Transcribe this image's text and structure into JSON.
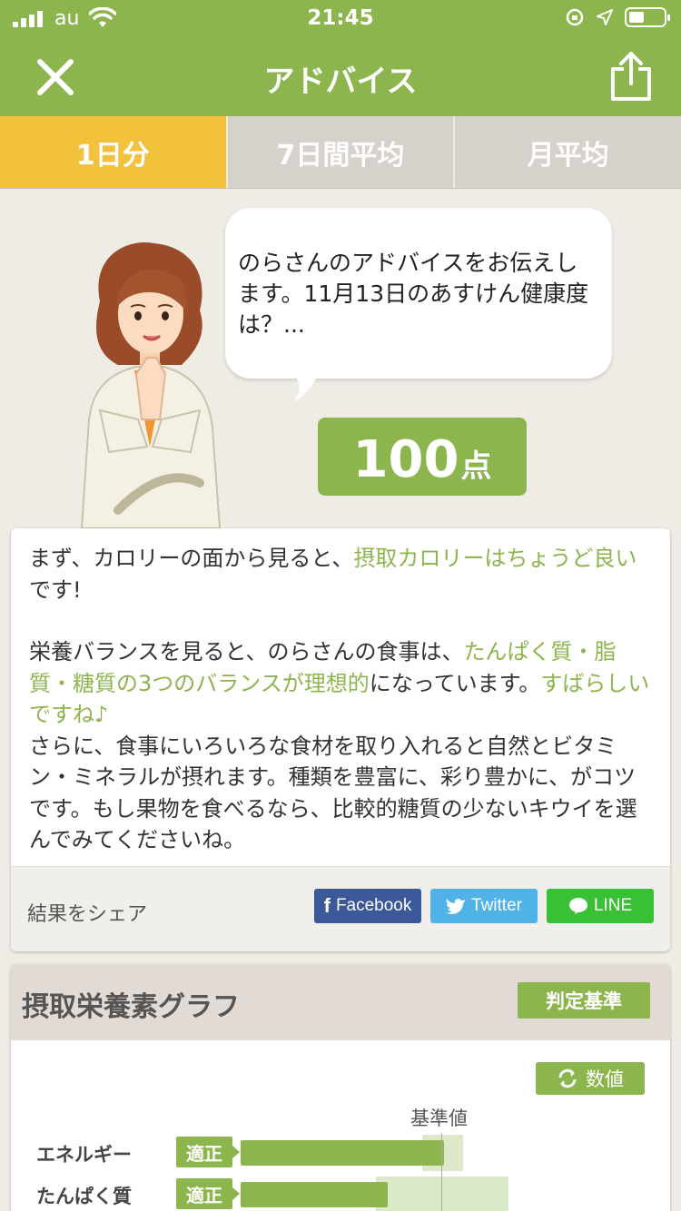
{
  "status_bar": {
    "carrier": "au",
    "time": "21:45"
  },
  "header": {
    "title": "アドバイス"
  },
  "tabs": [
    {
      "label": "1日分",
      "active": true
    },
    {
      "label": "7日間平均",
      "active": false
    },
    {
      "label": "月平均",
      "active": false
    }
  ],
  "bubble": {
    "text": "のらさんのアドバイスをお伝えします。11月13日のあすけん健康度は？..."
  },
  "score": {
    "value": "100",
    "unit": "点"
  },
  "advice": {
    "p1_a": "まず、カロリーの面から見ると、",
    "p1_b": "摂取カロリーはちょうど良い",
    "p1_c": "です!",
    "p2_a": "栄養バランスを見ると、のらさんの食事は、",
    "p2_b": "たんぱく質・脂質・糖質の3つのバランスが理想的",
    "p2_c": "になっています。",
    "p2_d": "すばらしいですね♪",
    "p3": "さらに、食事にいろいろな食材を取り入れると自然とビタミン・ミネラルが摂れます。種類を豊富に、彩り豊かに、がコツです。もし果物を食べるなら、比較的糖質の少ないキウイを選んでみてくださいね。"
  },
  "share": {
    "label": "結果をシェア",
    "facebook": "Facebook",
    "twitter": "Twitter",
    "line": "LINE"
  },
  "graph": {
    "title": "摂取栄養素グラフ",
    "criteria_button": "判定基準",
    "values_button": "数値",
    "reference_label": "基準値",
    "rows": [
      {
        "label": "エネルギー",
        "status": "適正",
        "value_ratio": 1.0
      },
      {
        "label": "たんぱく質",
        "status": "適正",
        "value_ratio": 0.72
      }
    ]
  },
  "colors": {
    "accent": "#8db54d",
    "tab_active": "#f2c23c",
    "tab_inactive": "#d6d1cb",
    "facebook": "#3b5998",
    "twitter": "#4fb3e8",
    "line": "#3ac034"
  }
}
